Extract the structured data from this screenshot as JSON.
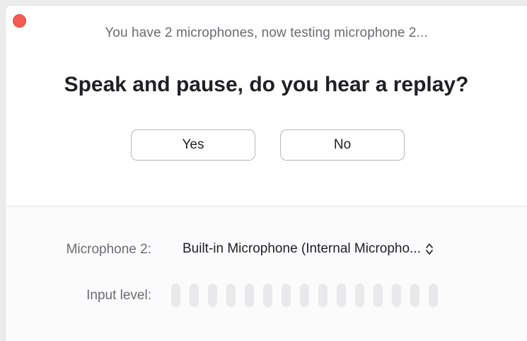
{
  "dialog": {
    "status_text": "You have 2 microphones, now testing microphone 2...",
    "question": "Speak and pause, do you hear a replay?",
    "yes_label": "Yes",
    "no_label": "No"
  },
  "settings": {
    "microphone_label": "Microphone 2:",
    "microphone_value": "Built-in Microphone (Internal Micropho...",
    "input_level_label": "Input level:",
    "input_level_segments": 15,
    "input_level_active": 0
  },
  "colors": {
    "close": "#f25b52",
    "meter_inactive": "#e9e9eb"
  },
  "icons": {
    "close": "close-dot-icon",
    "select": "updown-chevron-icon"
  }
}
